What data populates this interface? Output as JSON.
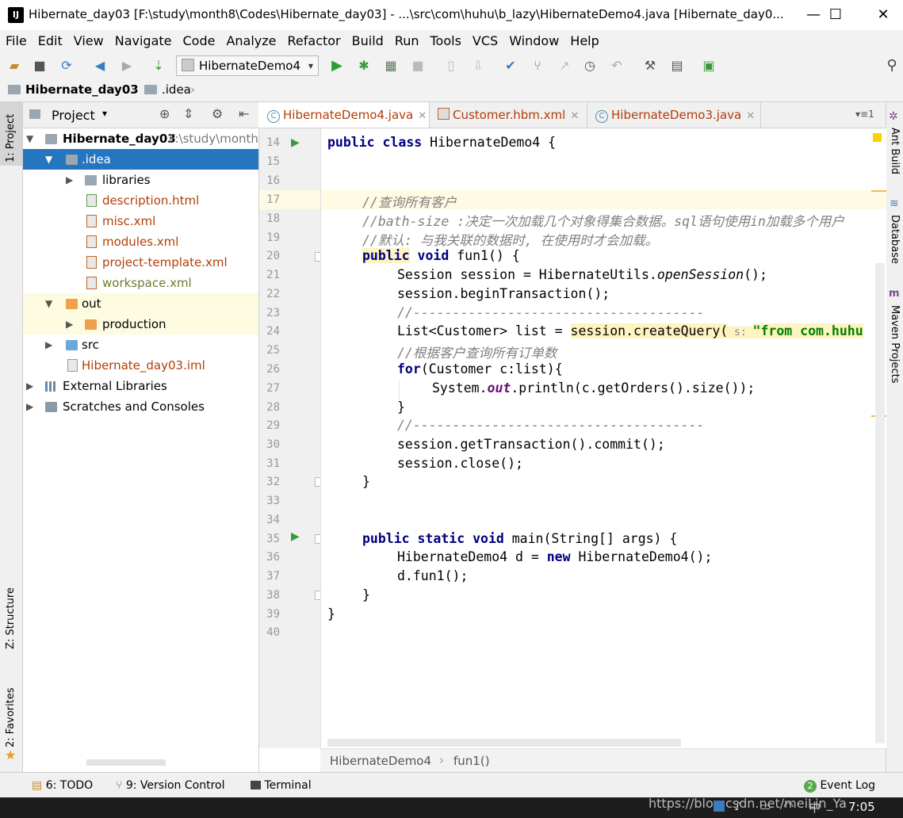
{
  "window": {
    "title": "Hibernate_day03 [F:\\study\\month8\\Codes\\Hibernate_day03] - ...\\src\\com\\huhu\\b_lazy\\HibernateDemo4.java [Hibernate_day0...",
    "minimize": "—",
    "maximize": "☐",
    "close": "✕"
  },
  "menu": [
    "File",
    "Edit",
    "View",
    "Navigate",
    "Code",
    "Analyze",
    "Refactor",
    "Build",
    "Run",
    "Tools",
    "VCS",
    "Window",
    "Help"
  ],
  "toolbar": {
    "run_config": "HibernateDemo4"
  },
  "navbar": {
    "project": "Hibernate_day03",
    "folder": ".idea"
  },
  "left_strip": {
    "project_tab": "1: Project",
    "structure_tab": "Z: Structure",
    "favorites_tab": "2: Favorites"
  },
  "right_strip": {
    "ant": "Ant Build",
    "database": "Database",
    "maven": "Maven Projects"
  },
  "project_panel": {
    "title": "Project",
    "tree": [
      {
        "label": "Hibernate_day03",
        "extra": "F:\\study\\month"
      },
      {
        "label": ".idea"
      },
      {
        "label": "libraries"
      },
      {
        "label": "description.html"
      },
      {
        "label": "misc.xml"
      },
      {
        "label": "modules.xml"
      },
      {
        "label": "project-template.xml"
      },
      {
        "label": "workspace.xml"
      },
      {
        "label": "out"
      },
      {
        "label": "production"
      },
      {
        "label": "src"
      },
      {
        "label": "Hibernate_day03.iml"
      },
      {
        "label": "External Libraries"
      },
      {
        "label": "Scratches and Consoles"
      }
    ]
  },
  "tabs": [
    {
      "label": "HibernateDemo4.java"
    },
    {
      "label": "Customer.hbm.xml"
    },
    {
      "label": "HibernateDemo3.java"
    }
  ],
  "tab_overflow": "1",
  "editor": {
    "line_numbers": [
      "14",
      "15",
      "16",
      "17",
      "18",
      "19",
      "20",
      "21",
      "22",
      "23",
      "24",
      "25",
      "26",
      "27",
      "28",
      "29",
      "30",
      "31",
      "32",
      "33",
      "34",
      "35",
      "36",
      "37",
      "38",
      "39",
      "40"
    ],
    "lines": {
      "l14_kw": "public class",
      "l14_rest": " HibernateDemo4 {",
      "l17": "//查询所有客户",
      "l18": "//bath-size :决定一次加载几个对象得集合数据。sql语句使用in加载多个用户",
      "l19": "//默认: 与我关联的数据时, 在使用时才会加载。",
      "l20_kw1": "public",
      "l20_kw2": " void",
      "l20_rest": " fun1() {",
      "l21_a": "Session session = HibernateUtils.",
      "l21_b": "openSession",
      "l21_c": "();",
      "l22": "session.beginTransaction();",
      "l23": "//-------------------------------------",
      "l24_a": "List<Customer> list = ",
      "l24_b": "session.createQuery(",
      "l24_hint": " s: ",
      "l24_str": "\"from",
      "l24_c": " com.huhu",
      "l25": "//根据客户查询所有订单数",
      "l26_kw": "for",
      "l26_rest": "(Customer c:list){",
      "l27_a": "System.",
      "l27_b": "out",
      "l27_c": ".println(c.getOrders().size());",
      "l28": "}",
      "l29": "//-------------------------------------",
      "l30": "session.getTransaction().commit();",
      "l31": "session.close();",
      "l32": "}",
      "l35_kw": "public static void",
      "l35_rest": " main(String[] args) {",
      "l36_a": "HibernateDemo4 d = ",
      "l36_kw": "new",
      "l36_b": " HibernateDemo4();",
      "l37": "d.fun1();",
      "l38": "}",
      "l39": "}"
    }
  },
  "breadcrumb": {
    "class": "HibernateDemo4",
    "method": "fun1()"
  },
  "bottom": {
    "todo": "6: TODO",
    "vcs": "9: Version Control",
    "terminal": "Terminal",
    "event_log": "Event Log",
    "event_count": "2"
  },
  "taskbar": {
    "watermark": "https://blog.csdn.net/meiLin_Ya",
    "clock": "7:05",
    "ime": "中"
  },
  "colors": {
    "selection": "#2675bf",
    "keyword": "#000080",
    "comment": "#808080",
    "file_xml": "#b33d06"
  }
}
